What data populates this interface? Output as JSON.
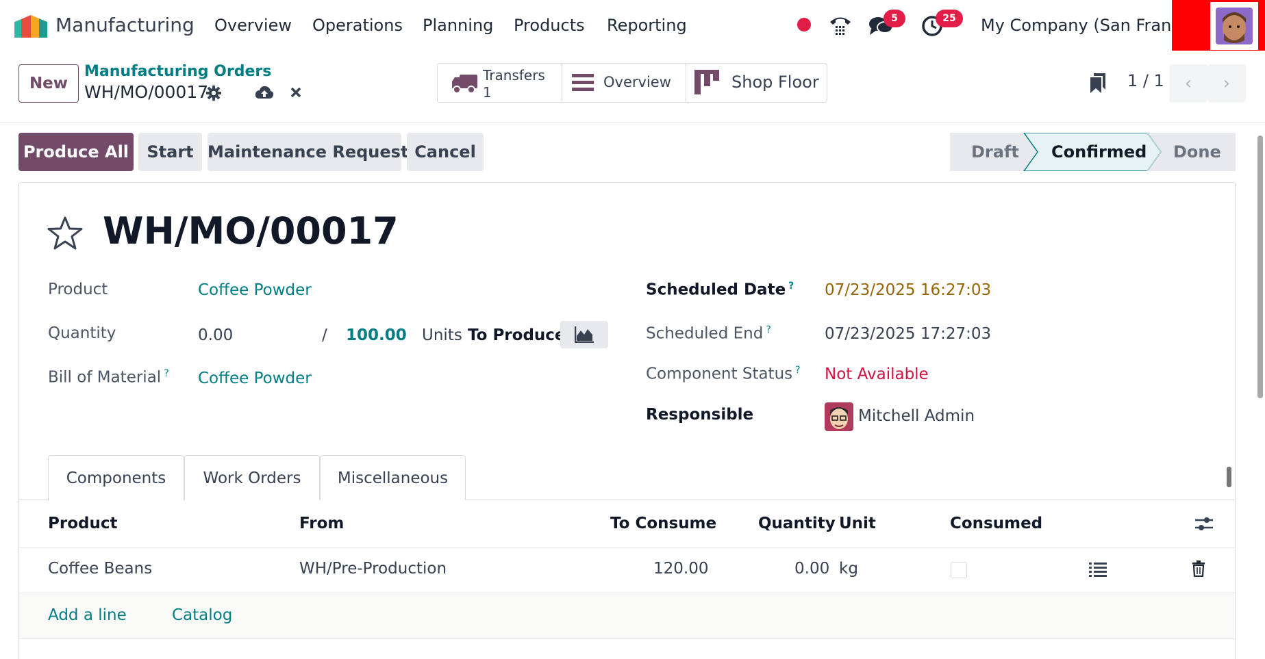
{
  "navbar": {
    "app_name": "Manufacturing",
    "menu": [
      "Overview",
      "Operations",
      "Planning",
      "Products",
      "Reporting"
    ],
    "messages_badge": "5",
    "activities_badge": "25",
    "company": "My Company (San Francisco)"
  },
  "control_panel": {
    "new_label": "New",
    "breadcrumb": "Manufacturing Orders",
    "record": "WH/MO/00017",
    "smart_buttons": {
      "transfers_label": "Transfers",
      "transfers_count": "1",
      "overview_label": "Overview",
      "shop_floor_label": "Shop Floor"
    },
    "pager": "1 / 1"
  },
  "actions": {
    "produce_all": "Produce All",
    "start": "Start",
    "maintenance": "Maintenance Request",
    "cancel": "Cancel"
  },
  "statusbar": {
    "stages": [
      "Draft",
      "Confirmed",
      "Done"
    ],
    "current": "Confirmed"
  },
  "form": {
    "title": "WH/MO/00017",
    "product_label": "Product",
    "product": "Coffee Powder",
    "quantity_label": "Quantity",
    "quantity_produced": "0.00",
    "slash": "/",
    "quantity_total": "100.00",
    "units": "Units",
    "to_produce": "To Produce",
    "bom_label": "Bill of Material",
    "bom": "Coffee Powder",
    "scheduled_date_label": "Scheduled Date",
    "scheduled_date": "07/23/2025 16:27:03",
    "scheduled_end_label": "Scheduled End",
    "scheduled_end": "07/23/2025 17:27:03",
    "component_status_label": "Component Status",
    "component_status": "Not Available",
    "responsible_label": "Responsible",
    "responsible": "Mitchell Admin",
    "help_mark": "?"
  },
  "tabs": [
    "Components",
    "Work Orders",
    "Miscellaneous"
  ],
  "components": {
    "headers": [
      "Product",
      "From",
      "To Consume",
      "Quantity",
      "Unit",
      "Consumed"
    ],
    "rows": [
      {
        "product": "Coffee Beans",
        "from": "WH/Pre-Production",
        "to_consume": "120.00",
        "quantity": "0.00",
        "unit": "kg"
      }
    ],
    "add_line": "Add a line",
    "catalog": "Catalog"
  },
  "colors": {
    "brand": "#714b67",
    "link": "#017e84",
    "danger": "#d40f41",
    "warning": "#956508"
  },
  "icons": [
    "debug-dot-icon",
    "phone-icon",
    "chat-icon",
    "clock-icon",
    "gear-icon",
    "cloud-upload-icon",
    "close-icon",
    "truck-icon",
    "list-icon",
    "kanban-icon",
    "bookmark-icon",
    "chevron-left-icon",
    "chevron-right-icon",
    "star-icon",
    "area-chart-icon",
    "settings-sliders-icon",
    "detail-list-icon",
    "trash-icon"
  ]
}
